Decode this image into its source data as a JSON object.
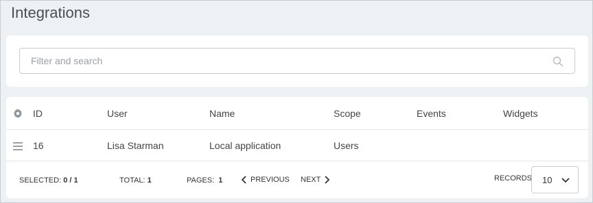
{
  "page": {
    "title": "Integrations"
  },
  "search": {
    "placeholder": "Filter and search"
  },
  "table": {
    "columns": [
      "ID",
      "User",
      "Name",
      "Scope",
      "Events",
      "Widgets"
    ],
    "rows": [
      {
        "id": "16",
        "user": "Lisa Starman",
        "name": "Local application",
        "scope": "Users",
        "events": "",
        "widgets": ""
      }
    ]
  },
  "footer": {
    "selected_label": "SELECTED:",
    "selected_value": "0 / 1",
    "total_label": "TOTAL:",
    "total_value": "1",
    "pages_label": "PAGES:",
    "pages_value": "1",
    "previous_label": "PREVIOUS",
    "next_label": "NEXT",
    "records_label": "RECORDS:",
    "records_value": "10"
  },
  "icons": {
    "settings": "gear-icon",
    "drag": "drag-handle-icon",
    "search": "search-icon",
    "prev": "chevron-left-icon",
    "next": "chevron-right-icon",
    "dropdown": "chevron-down-icon"
  }
}
